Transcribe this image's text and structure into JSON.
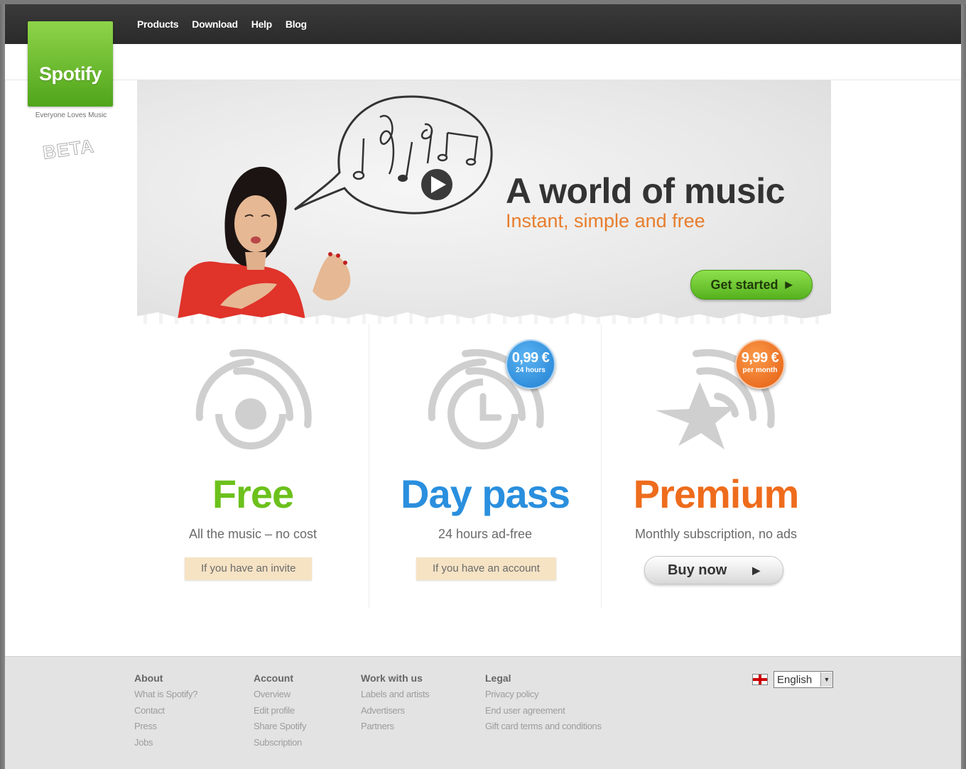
{
  "nav": {
    "items": [
      "Products",
      "Download",
      "Help",
      "Blog"
    ]
  },
  "brand": {
    "logo_text": "Spotify",
    "tagline": "Everyone Loves Music",
    "beta": "BETA"
  },
  "hero": {
    "title": "A world of music",
    "subtitle": "Instant, simple and free",
    "cta": "Get started"
  },
  "plans": [
    {
      "title": "Free",
      "description": "All the music – no cost",
      "action": "If you have an invite",
      "color": "#6cc11c"
    },
    {
      "title": "Day pass",
      "description": "24 hours ad-free",
      "action": "If you have an account",
      "badge_amount": "0,99 €",
      "badge_period": "24 hours",
      "color": "#2a8fde"
    },
    {
      "title": "Premium",
      "description": "Monthly subscription, no ads",
      "action": "Buy now",
      "badge_amount": "9,99 €",
      "badge_period": "per month",
      "color": "#ee6c1c"
    }
  ],
  "footer": {
    "columns": [
      {
        "heading": "About",
        "links": [
          "What is Spotify?",
          "Contact",
          "Press",
          "Jobs"
        ]
      },
      {
        "heading": "Account",
        "links": [
          "Overview",
          "Edit profile",
          "Share Spotify",
          "Subscription"
        ]
      },
      {
        "heading": "Work with us",
        "links": [
          "Labels and artists",
          "Advertisers",
          "Partners"
        ]
      },
      {
        "heading": "Legal",
        "links": [
          "Privacy policy",
          "End user agreement",
          "Gift card terms and conditions"
        ]
      }
    ],
    "language": "English"
  },
  "icons": {
    "play_arrow": "▶"
  }
}
